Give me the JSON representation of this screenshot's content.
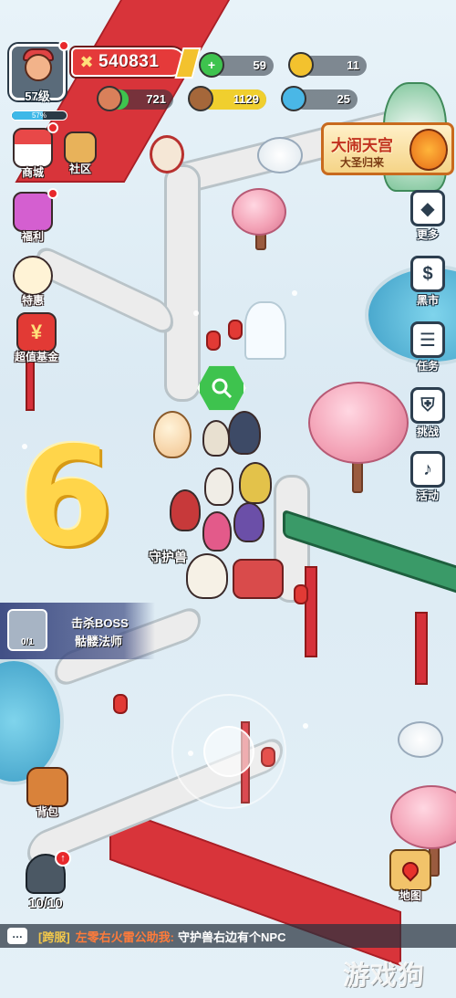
{
  "player": {
    "level": "57级",
    "xp_percent": "57%",
    "xp_fraction": 0.57
  },
  "power": {
    "value": "540831"
  },
  "resources": {
    "gems": "59",
    "gold": "11",
    "meat": "721",
    "wood": "1129",
    "crystal": "25"
  },
  "left_menu": {
    "shop": "商城",
    "community": "社区",
    "welfare": "福利",
    "deals": "特惠",
    "fund": "超值基金"
  },
  "right_menu": {
    "more": "更多",
    "black_market": "黑市",
    "tasks": "任务",
    "challenge": "挑战",
    "events": "活动"
  },
  "event_banner": {
    "title": "大闹天宫",
    "subtitle": "大圣归来"
  },
  "quest": {
    "line1": "击杀BOSS",
    "line2": "骷髅法师",
    "progress": "0/1"
  },
  "scene": {
    "pet_label": "守护兽"
  },
  "bottom": {
    "bag": "背包",
    "troops": "10/10",
    "map": "地图"
  },
  "chat": {
    "tag": "[跨服]",
    "name": "左零右火雷公助我:",
    "message": "守护兽右边有个NPC"
  },
  "watermark": "游戏狗",
  "colors": {
    "power_red": "#e53a3a",
    "gem_green": "#3ec34e",
    "gold": "#f3c22e",
    "carpet_red": "#d8343a"
  }
}
